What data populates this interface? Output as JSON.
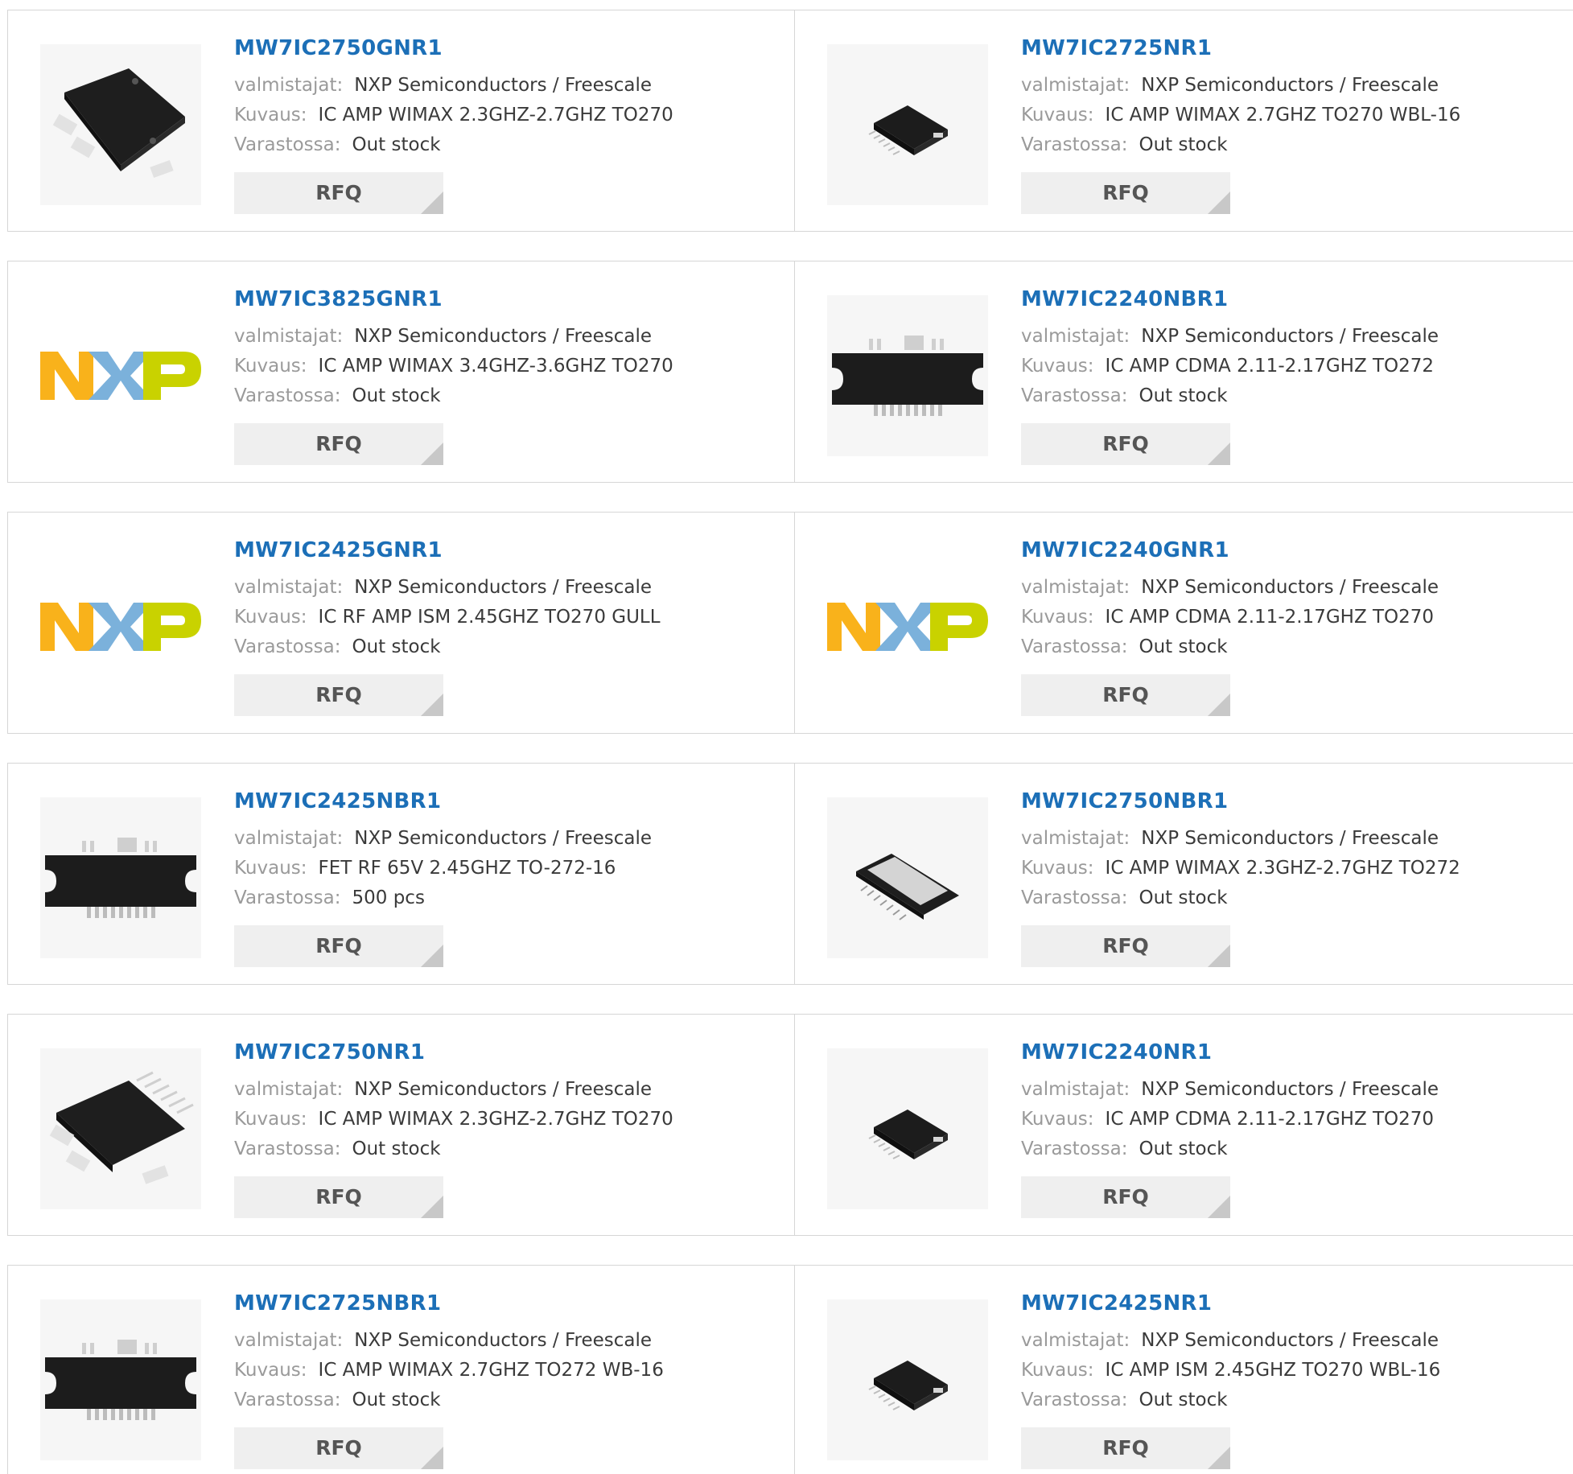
{
  "labels": {
    "manufacturer": "valmistajat:",
    "description": "Kuvaus:",
    "stock": "Varastossa:",
    "rfq": "RFQ"
  },
  "colors": {
    "part_link": "#1c6fb7",
    "label": "#9a9a9a",
    "value": "#3a3a3a",
    "border": "#d6d6d6",
    "rfq_bg": "#efefef",
    "nxp_orange": "#f9b21b",
    "nxp_blue": "#7bb1db",
    "nxp_green": "#c9d200"
  },
  "products": [
    {
      "part": "MW7IC2750GNR1",
      "manufacturer": "NXP Semiconductors / Freescale",
      "description": "IC AMP WIMAX 2.3GHZ-2.7GHZ TO270",
      "stock": "Out stock",
      "image": "ic-to270-large-image"
    },
    {
      "part": "MW7IC2725NR1",
      "manufacturer": "NXP Semiconductors / Freescale",
      "description": "IC AMP WIMAX 2.7GHZ TO270 WBL-16",
      "stock": "Out stock",
      "image": "ic-small-package-image"
    },
    {
      "part": "MW7IC3825GNR1",
      "manufacturer": "NXP Semiconductors / Freescale",
      "description": "IC AMP WIMAX 3.4GHZ-3.6GHZ TO270",
      "stock": "Out stock",
      "image": "nxp-logo-image"
    },
    {
      "part": "MW7IC2240NBR1",
      "manufacturer": "NXP Semiconductors / Freescale",
      "description": "IC AMP CDMA 2.11-2.17GHZ TO272",
      "stock": "Out stock",
      "image": "ic-to272-flange-image"
    },
    {
      "part": "MW7IC2425GNR1",
      "manufacturer": "NXP Semiconductors / Freescale",
      "description": "IC RF AMP ISM 2.45GHZ TO270 GULL",
      "stock": "Out stock",
      "image": "nxp-logo-image"
    },
    {
      "part": "MW7IC2240GNR1",
      "manufacturer": "NXP Semiconductors / Freescale",
      "description": "IC AMP CDMA 2.11-2.17GHZ TO270",
      "stock": "Out stock",
      "image": "nxp-logo-image"
    },
    {
      "part": "MW7IC2425NBR1",
      "manufacturer": "NXP Semiconductors / Freescale",
      "description": "FET RF 65V 2.45GHZ TO-272-16",
      "stock": "500 pcs",
      "image": "ic-to272-flange-image"
    },
    {
      "part": "MW7IC2750NBR1",
      "manufacturer": "NXP Semiconductors / Freescale",
      "description": "IC AMP WIMAX 2.3GHZ-2.7GHZ TO272",
      "stock": "Out stock",
      "image": "ic-to272-angled-image"
    },
    {
      "part": "MW7IC2750NR1",
      "manufacturer": "NXP Semiconductors / Freescale",
      "description": "IC AMP WIMAX 2.3GHZ-2.7GHZ TO270",
      "stock": "Out stock",
      "image": "ic-to270-leads-image"
    },
    {
      "part": "MW7IC2240NR1",
      "manufacturer": "NXP Semiconductors / Freescale",
      "description": "IC AMP CDMA 2.11-2.17GHZ TO270",
      "stock": "Out stock",
      "image": "ic-small-package-image"
    },
    {
      "part": "MW7IC2725NBR1",
      "manufacturer": "NXP Semiconductors / Freescale",
      "description": "IC AMP WIMAX 2.7GHZ TO272 WB-16",
      "stock": "Out stock",
      "image": "ic-to272-flange-image"
    },
    {
      "part": "MW7IC2425NR1",
      "manufacturer": "NXP Semiconductors / Freescale",
      "description": "IC AMP ISM 2.45GHZ TO270 WBL-16",
      "stock": "Out stock",
      "image": "ic-small-package-image"
    }
  ]
}
